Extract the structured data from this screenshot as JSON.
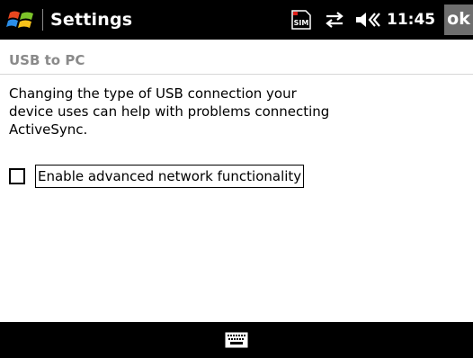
{
  "titlebar": {
    "title": "Settings",
    "clock": "11:45",
    "ok_label": "ok",
    "sim_label": "SIM",
    "icons": [
      "windows-start-icon",
      "sim-icon",
      "connectivity-icon",
      "volume-icon"
    ]
  },
  "subheader": {
    "title": "USB to PC"
  },
  "content": {
    "description": "Changing the type of USB connection your device uses can help with problems connecting ActiveSync.",
    "checkbox": {
      "label": "Enable advanced network functionality",
      "checked": false
    }
  },
  "bottombar": {
    "icons": [
      "keyboard-icon"
    ]
  }
}
